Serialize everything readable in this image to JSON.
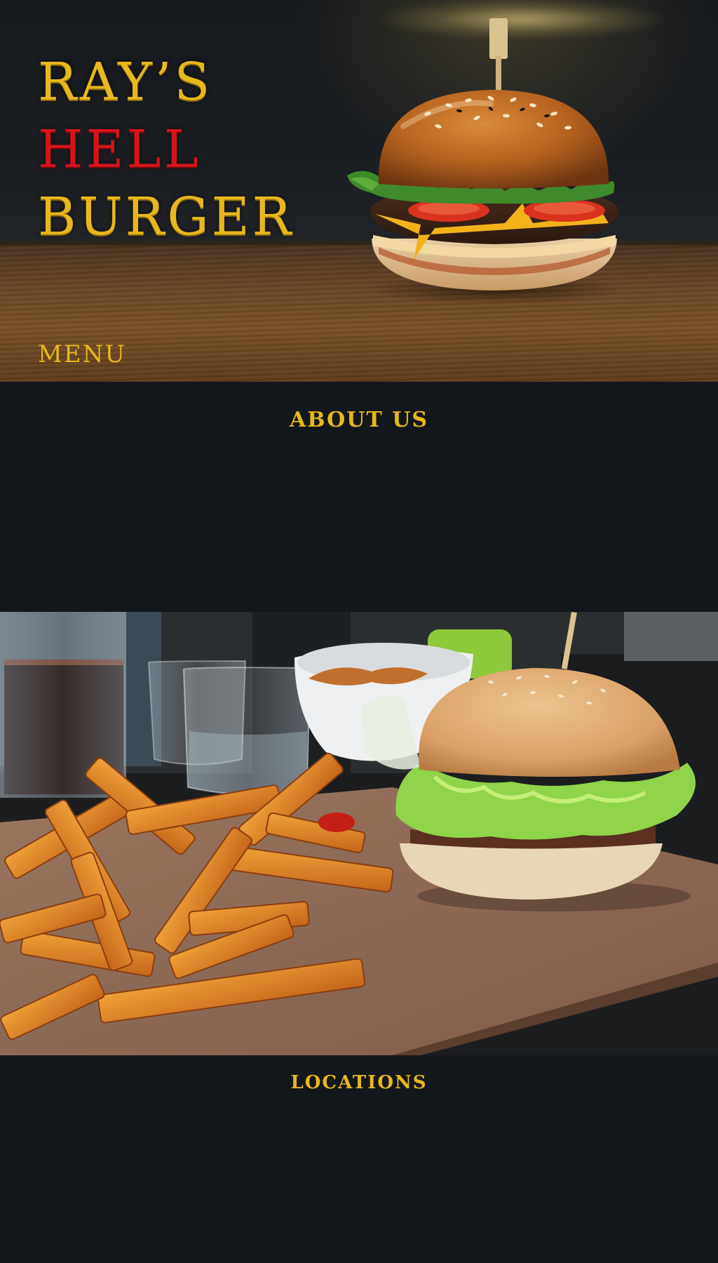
{
  "hero": {
    "title_lines": [
      "RAY’S",
      "HELL",
      "BURGER"
    ],
    "menu_label": "MENU",
    "image_alt": "burger-on-wooden-table-photo"
  },
  "about": {
    "heading": "ABOUT US"
  },
  "photo": {
    "image_alt": "burger-and-fries-photo"
  },
  "locations": {
    "heading": "LOCATIONS"
  },
  "colors": {
    "background": "#12171c",
    "gold": "#e7b81c",
    "red": "#d4141c"
  }
}
